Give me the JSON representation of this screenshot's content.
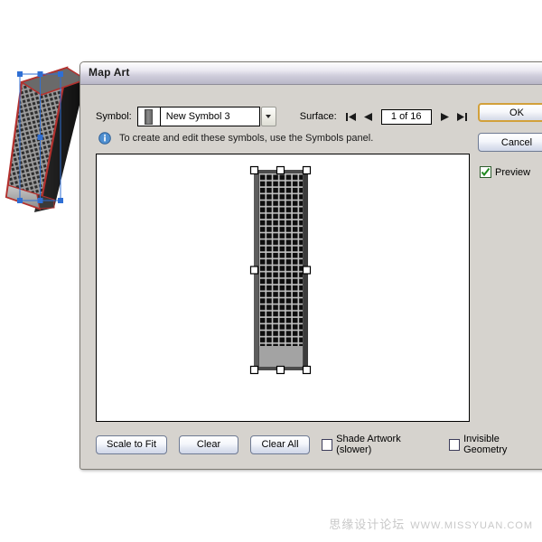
{
  "canvas": {
    "background_color": "#ffffff",
    "watermark_cn": "思缘设计论坛",
    "watermark_url": "WWW.MISSYUAN.COM"
  },
  "artwork_object": {
    "name": "3d-extruded-harmonica-object",
    "outline_color": "#b3312e",
    "surface_color": "#9a9a9a",
    "selection_color": "#2f6fd4",
    "description": "3D extruded mesh object with Illustrator selection bounding box"
  },
  "dialog": {
    "title": "Map Art",
    "symbol": {
      "label": "Symbol:",
      "selected": "New Symbol 3",
      "thumbnail": "symbol-thumbnail",
      "dropdown_icon": "chevron-down-icon"
    },
    "surface": {
      "label": "Surface:",
      "first_icon": "first-surface-icon",
      "previous_icon": "previous-surface-icon",
      "value": "1 of 16",
      "next_icon": "next-surface-icon",
      "last_icon": "last-surface-icon"
    },
    "info": {
      "icon": "info-icon",
      "text": "To create and edit these symbols, use the Symbols panel."
    },
    "preview_canvas": {
      "name": "map-art-preview-canvas",
      "background_color": "#ffffff",
      "artwork_fill": "#4a4a4a",
      "grid_line_color": "#b8b8b8",
      "handle_color": "#ffffff"
    },
    "buttons": {
      "scale_to_fit": "Scale to Fit",
      "clear": "Clear",
      "clear_all": "Clear All",
      "ok": "OK",
      "cancel": "Cancel"
    },
    "checkboxes": {
      "shade_artwork": {
        "label": "Shade Artwork (slower)",
        "checked": false
      },
      "invisible_geometry": {
        "label": "Invisible Geometry",
        "checked": false
      },
      "preview": {
        "label": "Preview",
        "checked": true,
        "check_color": "#1f8a1f"
      }
    }
  }
}
